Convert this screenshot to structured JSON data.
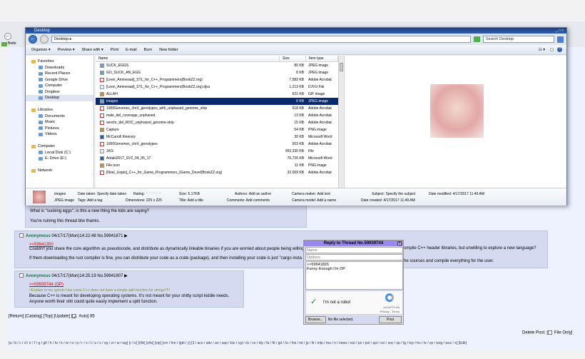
{
  "explorer": {
    "title": "Desktop",
    "address": "Desktop",
    "search_placeholder": "Search Desktop",
    "toolbar": [
      "Organize ▾",
      "Preview ▾",
      "Share with ▾",
      "Print",
      "E-mail",
      "Burn",
      "New folder"
    ],
    "nav": [
      {
        "label": "Favorites",
        "top": true
      },
      {
        "label": "Downloads"
      },
      {
        "label": "Recent Places"
      },
      {
        "label": "Google Drive"
      },
      {
        "label": "Computer"
      },
      {
        "label": "Dropbox"
      },
      {
        "label": "Desktop",
        "selected": true
      },
      {
        "label": ""
      },
      {
        "label": "Libraries",
        "top": true
      },
      {
        "label": "Documents"
      },
      {
        "label": "Music"
      },
      {
        "label": "Pictures"
      },
      {
        "label": "Videos"
      },
      {
        "label": ""
      },
      {
        "label": "Computer",
        "top": true
      },
      {
        "label": "Local Disk (C:)"
      },
      {
        "label": "E: Drive  (E:)"
      },
      {
        "label": ""
      },
      {
        "label": "Network",
        "top": true
      }
    ],
    "columns": [
      "Name",
      "Size",
      "Item type"
    ],
    "files": [
      {
        "name": "SUCK_EGGS",
        "size": "80 KB",
        "type": "JPEG image",
        "icon": "jpg"
      },
      {
        "name": "GO_SUCK_AN_EGG",
        "size": "8 KB",
        "type": "JPEG image",
        "icon": "jpg"
      },
      {
        "name": "[Leen_Ammeraal]_STL_for_C++_Programmers(BookZZ.org)",
        "size": "7,583 KB",
        "type": "Adobe Acrobat",
        "icon": "pdf"
      },
      {
        "name": "[Leen_Ammeraal]_STL_for_C++_Programmers(BookZZ.org).djvu",
        "size": "1,213 KB",
        "type": "DJVU File",
        "icon": "file"
      },
      {
        "name": "ALLAH",
        "size": "621 KB",
        "type": "GIF image",
        "icon": "png"
      },
      {
        "name": "images",
        "size": "6 KB",
        "type": "JPEG image",
        "icon": "jpg",
        "selected": true
      },
      {
        "name": "1000Genomes_chrX_genotypes_with_unphased_genome_strip",
        "size": "618 KB",
        "type": "Adobe Acrobat",
        "icon": "pdf"
      },
      {
        "name": "male_del_coverage_unphased",
        "size": "13 KB",
        "type": "Adobe Acrobat",
        "icon": "pdf"
      },
      {
        "name": "sexchr_del_ROC_unphased_genome-strip",
        "size": "15 KB",
        "type": "Adobe Acrobat",
        "icon": "pdf"
      },
      {
        "name": "Capture",
        "size": "54 KB",
        "type": "PNG image",
        "icon": "png"
      },
      {
        "name": "McCarroll Itinerary",
        "size": "30 KB",
        "type": "Microsoft Word",
        "icon": "doc"
      },
      {
        "name": "1000Genomes_chrX_genotypes",
        "size": "503 KB",
        "type": "Adobe Acrobat",
        "icon": "pdf"
      },
      {
        "name": "1KG",
        "size": "993,330 KB",
        "type": "File",
        "icon": "file"
      },
      {
        "name": "Antaki2017_SV2_04_05_17",
        "size": "76,726 KB",
        "type": "Microsoft Word",
        "icon": "doc"
      },
      {
        "name": "File-icon",
        "size": "11 KB",
        "type": "PNG image",
        "icon": "png"
      },
      {
        "name": "[Noel_Llopis]_C++_for_Game_Programmers_(Game_Devel(BookZZ.org)",
        "size": "32,069 KB",
        "type": "Adobe Acrobat",
        "icon": "pdf"
      }
    ],
    "details": {
      "name": "images",
      "kind": "JPEG image",
      "date_taken": "Date taken: Specify date taken",
      "tags": "Tags: Add a tag",
      "rating": "Rating:",
      "rating_stars": "☆☆☆☆☆",
      "dimensions": "Dimensions: 225 x 225",
      "size": "Size: 5.17KB",
      "title": "Title: Add a title",
      "authors": "Authors: Add an author",
      "comments": "Comments: Add comments",
      "camera_maker": "Camera maker: Add text",
      "camera_model": "Camera model: Add a name",
      "subject": "Subject: Specify the subject",
      "date_created": "Date created: 4/17/2017 11:49 AM",
      "date_modified": "Date modified: 4/17/2017 11:49 AM"
    }
  },
  "browser": {
    "bookmark": "Bette"
  },
  "posts": [
    {
      "lines": [
        "What is \"sucking eggs\", is this a new thing the kids are saying?",
        "You're ruining this thread btw thanks."
      ]
    },
    {
      "name": "Anonymous",
      "meta": "04/17/17(Mon)14:22:48 No.59941871",
      "quote": ">>59941350",
      "lines": [
        "Couldn't you share the core algorithm as pseudocode, and distribute as dynamically linkable binaries if you are worried about people being willing",
        "If them downloading the rust compiler is fine, you can distribute your code as a crate (package), and then installing your crate is just \"cargo insta"
      ],
      "lines_right": [
        "ompile C++ header libraries, but unwilling to explore a new language?",
        "he sources and compile everything for the user."
      ]
    },
    {
      "name": "Anonymous",
      "meta": "04/17/17(Mon)14:25:19 No.59941907",
      "quote": ">>59939744 (OP)",
      "greentext": ">Explain to me /g/ents how come C++ does not have a simple split function for strings?!!!",
      "lines": [
        "Because C++ is meant for developing operating systems. It's not meant for your shitty script kiddie needs.",
        "Anyone worth their shit could quite easily implement a split function."
      ]
    }
  ],
  "reply": {
    "title": "Reply to Thread No.59939744",
    "name_placeholder": "Name",
    "options_placeholder": "Options",
    "comment": ">>59941826\nFunny Enough I'm OP",
    "captcha": "I'm not a robot",
    "recaptcha": "reCAPTCHA",
    "privacy": "Privacy - Terms",
    "browse": "Browse...",
    "no_file": "No file selected.",
    "post": "Post"
  },
  "footer": {
    "links": "[Return] [Catalog] [Top] [Update] [",
    "auto": "Auto] 85",
    "delete": "Delete Post: [",
    "file_only": "File Only]",
    "boards": "[a / b / c / d / e / f / g / gif / h / hr / k / m / o / p / r / s / t / u / v / vg / vr / w / wg] [i / ic] [r9k] [s4s] [vip] [cm / hm / lgbt / y] [3 / aco / adv / an / asp / biz / cgl / ck / co / diy / fa / fit / gd / hc / his / int / jp / lit / mlp / mu / n / news / out / po / pol / qst / sci / soc / sp / tg / toy / trv / tv / vp / wsg / wsx / x] [Edit]"
  }
}
